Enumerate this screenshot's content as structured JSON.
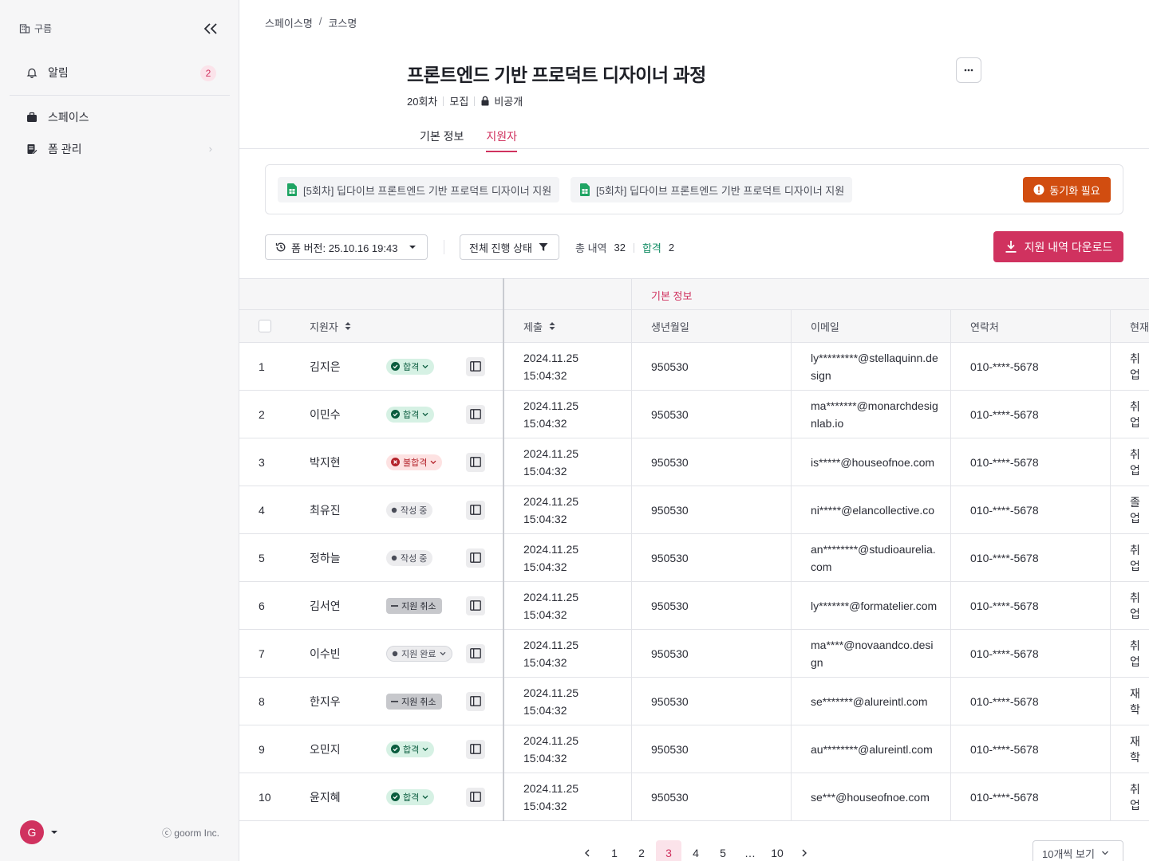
{
  "sidebar": {
    "brand": "구름",
    "items": [
      {
        "label": "알림",
        "badge": "2"
      },
      {
        "label": "스페이스"
      },
      {
        "label": "폼 관리"
      }
    ],
    "avatar_initial": "G",
    "copyright": "ⓒ goorm Inc."
  },
  "breadcrumb": {
    "space": "스페이스명",
    "separator": "/",
    "course": "코스명"
  },
  "course": {
    "title": "프론트엔드 기반 프로덕트 디자이너 과정",
    "round": "20회차",
    "status": "모집",
    "visibility": "비공개"
  },
  "tabs": [
    {
      "label": "기본 정보",
      "active": false
    },
    {
      "label": "지원자",
      "active": true
    }
  ],
  "sheets": [
    {
      "label": "[5회차] 딥다이브 프론트엔드 기반 프로덕트 디자이너 지원",
      "icon": "google-sheets-icon"
    },
    {
      "label": "[5회차] 딥다이브 프론트엔드 기반 프로덕트 디자이너 지원",
      "icon": "google-sheets-icon"
    }
  ],
  "sync_button": "동기화 필요",
  "toolbar": {
    "version": "폼 버전: 25.10.16 19:43",
    "status_filter": "전체 진행 상태",
    "total_label": "총 내역",
    "total_count": "32",
    "pass_label": "합격",
    "pass_count": "2",
    "download": "지원 내역 다운로드"
  },
  "table": {
    "group_header": "기본 정보",
    "columns": {
      "applicant": "지원자",
      "submitted": "제출",
      "birth": "생년월일",
      "email": "이메일",
      "phone": "연락처",
      "current": "현재"
    },
    "rows": [
      {
        "no": "1",
        "name": "김지은",
        "status": "합격",
        "kind": "pass",
        "date": "2024.11.25",
        "time": "15:04:32",
        "birth": "950530",
        "email": "ly*********@stellaquinn.design",
        "phone": "010-****-5678",
        "current": "취업"
      },
      {
        "no": "2",
        "name": "이민수",
        "status": "합격",
        "kind": "pass",
        "date": "2024.11.25",
        "time": "15:04:32",
        "birth": "950530",
        "email": "ma*******@monarchdesignlab.io",
        "phone": "010-****-5678",
        "current": "취업"
      },
      {
        "no": "3",
        "name": "박지현",
        "status": "불합격",
        "kind": "fail",
        "date": "2024.11.25",
        "time": "15:04:32",
        "birth": "950530",
        "email": "is*****@houseofnoe.com",
        "phone": "010-****-5678",
        "current": "취업"
      },
      {
        "no": "4",
        "name": "최유진",
        "status": "작성 중",
        "kind": "draft",
        "date": "2024.11.25",
        "time": "15:04:32",
        "birth": "950530",
        "email": "ni*****@elancollective.co",
        "phone": "010-****-5678",
        "current": "졸업"
      },
      {
        "no": "5",
        "name": "정하늘",
        "status": "작성 중",
        "kind": "draft",
        "date": "2024.11.25",
        "time": "15:04:32",
        "birth": "950530",
        "email": "an********@studioaurelia.com",
        "phone": "010-****-5678",
        "current": "취업"
      },
      {
        "no": "6",
        "name": "김서연",
        "status": "지원 취소",
        "kind": "cancel",
        "date": "2024.11.25",
        "time": "15:04:32",
        "birth": "950530",
        "email": "ly*******@formatelier.com",
        "phone": "010-****-5678",
        "current": "취업"
      },
      {
        "no": "7",
        "name": "이수빈",
        "status": "지원 완료",
        "kind": "done",
        "date": "2024.11.25",
        "time": "15:04:32",
        "birth": "950530",
        "email": "ma****@novaandco.design",
        "phone": "010-****-5678",
        "current": "취업"
      },
      {
        "no": "8",
        "name": "한지우",
        "status": "지원 취소",
        "kind": "cancel",
        "date": "2024.11.25",
        "time": "15:04:32",
        "birth": "950530",
        "email": "se*******@alureintl.com",
        "phone": "010-****-5678",
        "current": "재학"
      },
      {
        "no": "9",
        "name": "오민지",
        "status": "합격",
        "kind": "pass",
        "date": "2024.11.25",
        "time": "15:04:32",
        "birth": "950530",
        "email": "au********@alureintl.com",
        "phone": "010-****-5678",
        "current": "재학"
      },
      {
        "no": "10",
        "name": "윤지혜",
        "status": "합격",
        "kind": "pass",
        "date": "2024.11.25",
        "time": "15:04:32",
        "birth": "950530",
        "email": "se***@houseofnoe.com",
        "phone": "010-****-5678",
        "current": "취업"
      }
    ]
  },
  "pagination": {
    "pages": [
      "1",
      "2",
      "3",
      "4",
      "5",
      "…",
      "10"
    ],
    "current": "3",
    "per_page": "10개씩 보기"
  },
  "colors": {
    "brand": "#d0325f",
    "sync": "#d14d10",
    "pass": "#0e8a61"
  }
}
